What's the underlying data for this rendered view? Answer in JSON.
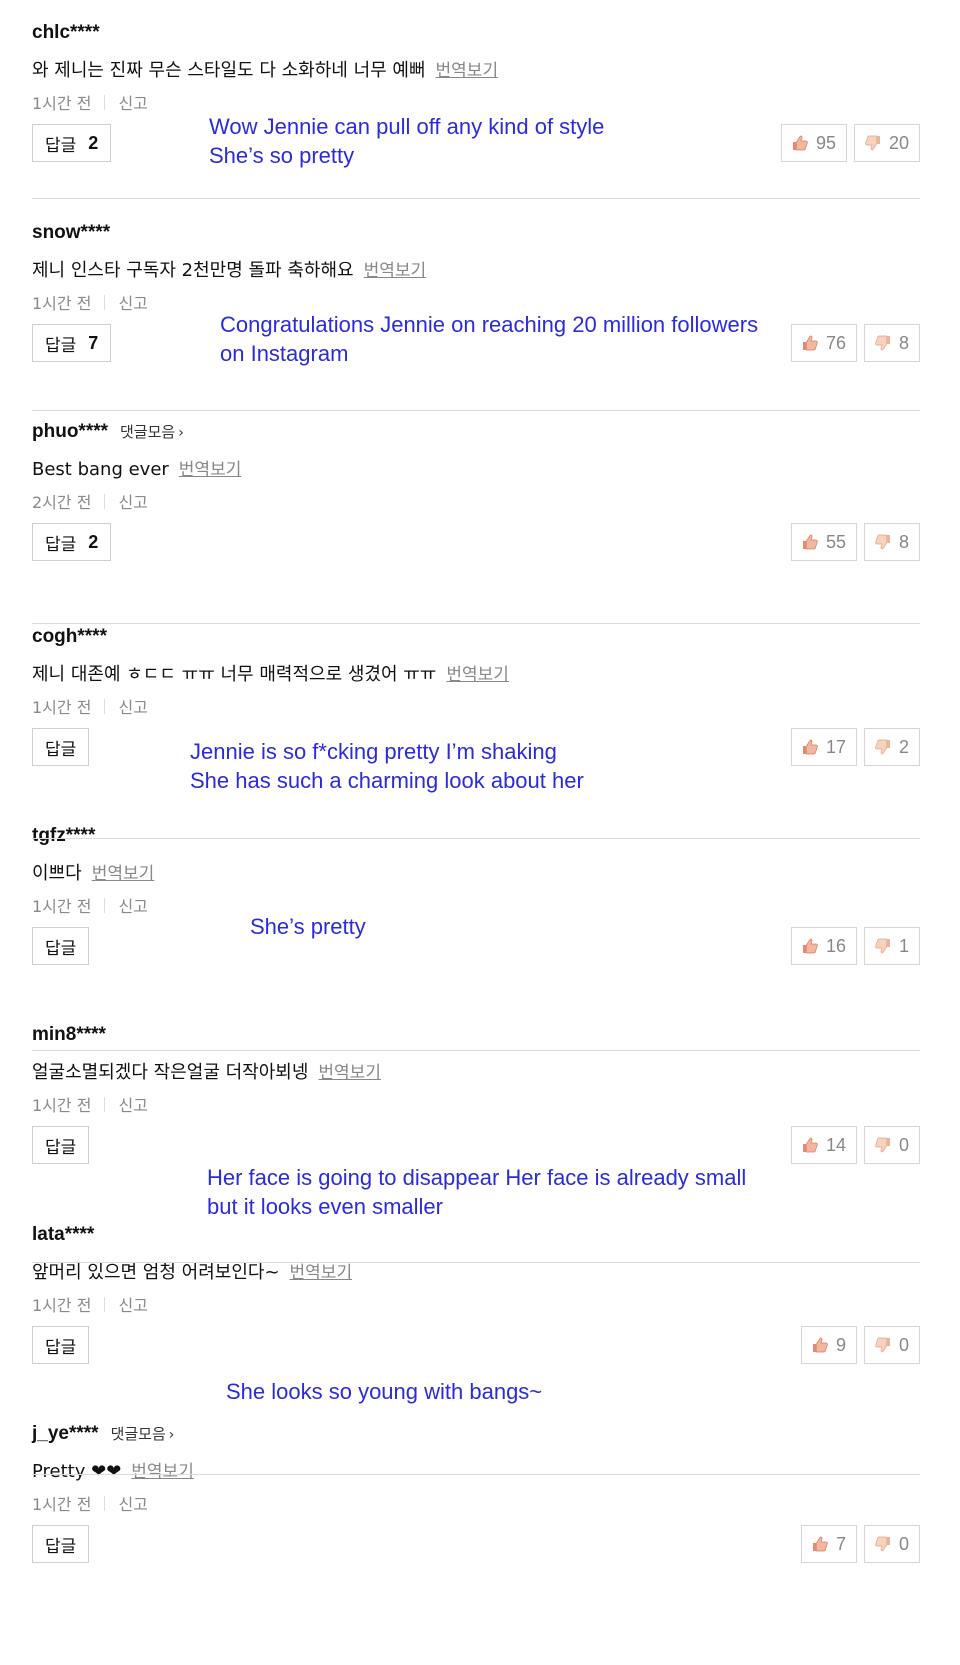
{
  "labels": {
    "reply": "답글",
    "report": "신고",
    "translate": "번역보기",
    "collect": "댓글모음"
  },
  "colors": {
    "translation": "#2b2bdc",
    "muted": "#888888",
    "border": "#d6d6d6"
  },
  "comments": [
    {
      "user": "chlc****",
      "text": "와 제니는 진짜 무슨 스타일도 다 소화하네 너무 예뻐",
      "time": "1시간 전",
      "replies": "2",
      "likes": "95",
      "dislikes": "20",
      "translation": [
        "Wow Jennie can pull off any kind of style",
        "She’s so pretty"
      ]
    },
    {
      "user": "snow****",
      "text": "제니 인스타 구독자 2천만명 돌파 축하해요",
      "time": "1시간 전",
      "replies": "7",
      "likes": "76",
      "dislikes": "8",
      "translation": [
        "Congratulations Jennie on reaching 20 million followers",
        "on Instagram"
      ]
    },
    {
      "user": "phuo****",
      "collect": true,
      "text": "Best bang ever",
      "time": "2시간 전",
      "replies": "2",
      "likes": "55",
      "dislikes": "8",
      "translation": []
    },
    {
      "user": "cogh****",
      "text": "제니 대존예 ㅎㄷㄷ ㅠㅠ 너무 매력적으로 생겼어 ㅠㅠ",
      "time": "1시간 전",
      "replies": "",
      "likes": "17",
      "dislikes": "2",
      "translation": [
        "Jennie is so f*cking pretty I’m shaking",
        "She has such a charming look about her"
      ]
    },
    {
      "user": "tgfz****",
      "text": "이쁘다",
      "time": "1시간 전",
      "replies": "",
      "likes": "16",
      "dislikes": "1",
      "translation": [
        "She’s pretty"
      ]
    },
    {
      "user": "min8****",
      "text": "얼굴소멸되겠다 작은얼굴 더작아뵈넹",
      "time": "1시간 전",
      "replies": "",
      "likes": "14",
      "dislikes": "0",
      "translation": [
        "Her face is going to disappear Her face is already small",
        "but it looks even smaller"
      ]
    },
    {
      "user": "lata****",
      "text": "앞머리 있으면 엄청 어려보인다~",
      "time": "1시간 전",
      "replies": "",
      "likes": "9",
      "dislikes": "0",
      "translation": [
        "She looks so young with bangs~"
      ]
    },
    {
      "user": "j_ye****",
      "collect": true,
      "text": "Pretty ❤❤",
      "time": "1시간 전",
      "replies": "",
      "likes": "7",
      "dislikes": "0",
      "translation": []
    }
  ]
}
